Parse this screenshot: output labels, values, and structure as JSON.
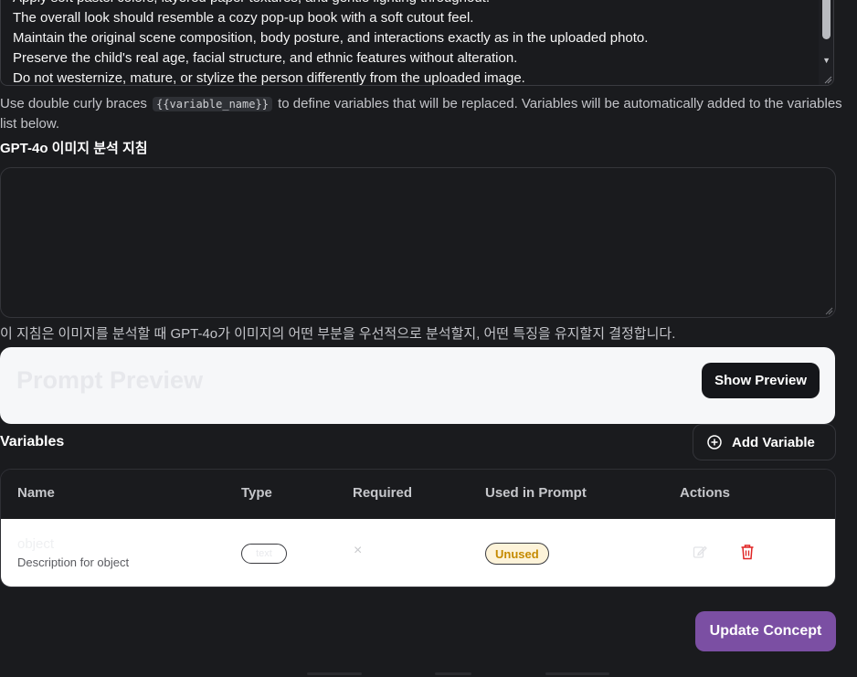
{
  "prompt": {
    "lines": [
      "Apply soft pastel colors, layered paper textures, and gentle lighting throughout.",
      "The overall look should resemble a cozy pop-up book with a soft cutout feel.",
      "Maintain the original scene composition, body posture, and interactions exactly as in the uploaded photo.",
      "Preserve the child's real age, facial structure, and ethnic features without alteration.",
      "Do not westernize, mature, or stylize the person differently from the uploaded image."
    ]
  },
  "helper": {
    "before": "Use double curly braces",
    "code": "{{variable_name}}",
    "after": "to define variables that will be replaced. Variables will be automatically added to the variables list below."
  },
  "gpt_instructions": {
    "label": "GPT-4o 이미지 분석 지침",
    "value": "",
    "help": "이 지침은 이미지를 분석할 때 GPT-4o가 이미지의 어떤 부분을 우선적으로 분석할지, 어떤 특징을 유지할지 결정합니다."
  },
  "preview": {
    "title": "Prompt Preview",
    "button": "Show Preview"
  },
  "variables": {
    "title": "Variables",
    "add_button": "Add Variable",
    "columns": [
      "Name",
      "Type",
      "Required",
      "Used in Prompt",
      "Actions"
    ],
    "rows": [
      {
        "name": "object",
        "description": "Description for object",
        "type": "text",
        "required": "×",
        "used": "Unused"
      }
    ]
  },
  "footer": {
    "update_button": "Update Concept"
  },
  "icons": {
    "add": "plus-circle-icon",
    "edit": "edit-icon",
    "delete": "trash-icon",
    "scroll": "chevron-down-icon"
  },
  "colors": {
    "background": "#1a1b1e",
    "accent": "#7b4fa3",
    "danger": "#e02424",
    "warning": "#c58a00"
  }
}
